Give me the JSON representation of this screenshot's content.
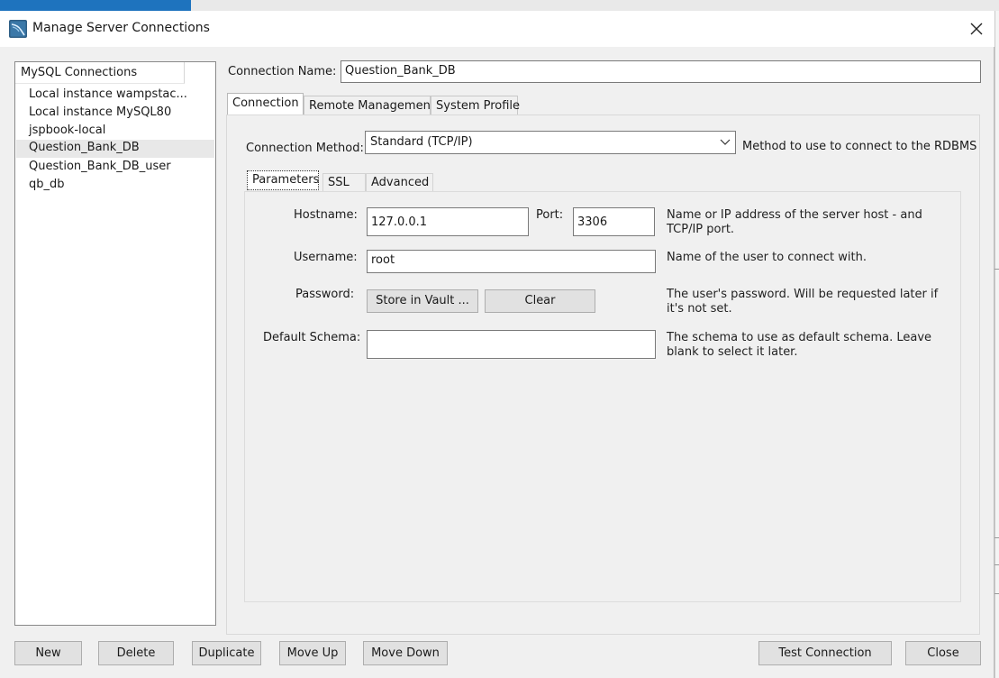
{
  "window": {
    "title": "Manage Server Connections"
  },
  "connections": {
    "header": "MySQL Connections",
    "items": [
      {
        "label": "Local instance wampstac..."
      },
      {
        "label": "Local instance MySQL80"
      },
      {
        "label": "jspbook-local"
      },
      {
        "label": "Question_Bank_DB",
        "selected": true
      },
      {
        "label": "Question_Bank_DB_user"
      },
      {
        "label": "qb_db"
      }
    ]
  },
  "connection_name": {
    "label": "Connection Name:",
    "value": "Question_Bank_DB"
  },
  "tabs": [
    {
      "label": "Connection",
      "active": true
    },
    {
      "label": "Remote Management"
    },
    {
      "label": "System Profile"
    }
  ],
  "connection_method": {
    "label": "Connection Method:",
    "value": "Standard (TCP/IP)",
    "help": "Method to use to connect to the RDBMS"
  },
  "subtabs": [
    {
      "label": "Parameters",
      "active": true
    },
    {
      "label": "SSL"
    },
    {
      "label": "Advanced"
    }
  ],
  "params": {
    "hostname": {
      "label": "Hostname:",
      "value": "127.0.0.1"
    },
    "port": {
      "label": "Port:",
      "value": "3306"
    },
    "hostname_help": "Name or IP address of the server host - and TCP/IP port.",
    "username": {
      "label": "Username:",
      "value": "root",
      "help": "Name of the user to connect with."
    },
    "password": {
      "label": "Password:",
      "store_button": "Store in Vault ...",
      "clear_button": "Clear",
      "help": "The user's password. Will be requested later if it's not set."
    },
    "schema": {
      "label": "Default Schema:",
      "value": "",
      "help": "The schema to use as default schema. Leave blank to select it later."
    }
  },
  "footer": {
    "new": "New",
    "delete": "Delete",
    "duplicate": "Duplicate",
    "move_up": "Move Up",
    "move_down": "Move Down",
    "test_connection": "Test Connection",
    "close": "Close"
  },
  "colors": {
    "accent": "#1e73be",
    "dialog_bg": "#f0f0f0",
    "selected_item": "#e8e8e8"
  },
  "icons": {
    "app": "mysql-workbench-icon",
    "close": "close-icon",
    "dropdown": "chevron-down-icon"
  }
}
